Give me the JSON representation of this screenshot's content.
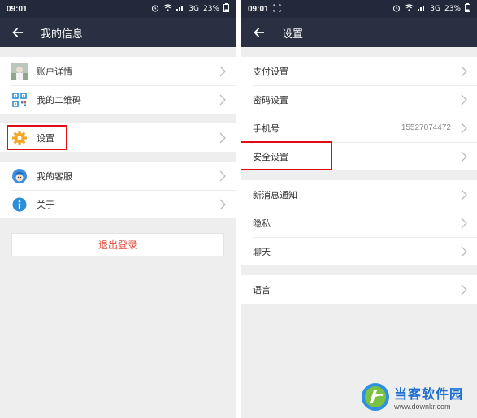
{
  "status_left": {
    "time": "09:01",
    "network": "3G",
    "battery": "23%"
  },
  "status_right": {
    "time": "09:01",
    "network": "3G",
    "battery": "23%"
  },
  "left_screen": {
    "title": "我的信息",
    "group1": [
      {
        "label": "账户详情",
        "icon": "avatar-thumbnail"
      },
      {
        "label": "我的二维码",
        "icon": "qr-code-icon"
      }
    ],
    "group2": [
      {
        "label": "设置",
        "icon": "gear-icon"
      }
    ],
    "group3": [
      {
        "label": "我的客服",
        "icon": "customer-service-icon"
      },
      {
        "label": "关于",
        "icon": "info-icon"
      }
    ],
    "logout_label": "退出登录"
  },
  "right_screen": {
    "title": "设置",
    "group1": [
      {
        "label": "支付设置"
      },
      {
        "label": "密码设置"
      },
      {
        "label": "手机号",
        "value": "15527074472"
      },
      {
        "label": "安全设置"
      }
    ],
    "group2": [
      {
        "label": "新消息通知"
      },
      {
        "label": "隐私"
      },
      {
        "label": "聊天"
      }
    ],
    "group3": [
      {
        "label": "语言"
      }
    ]
  },
  "watermark": {
    "title": "当客软件园",
    "url": "www.downkr.com"
  },
  "colors": {
    "appbar": "#2a2f42",
    "statusbar": "#23283a",
    "highlight": "#e00d12",
    "logout_text": "#e24b3c",
    "watermark_brand": "#1f6fd0"
  }
}
